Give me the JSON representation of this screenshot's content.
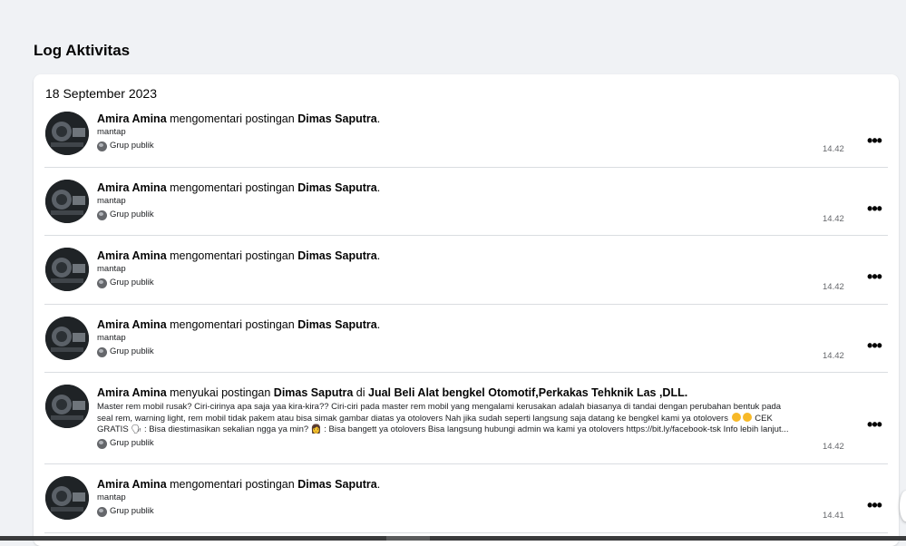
{
  "page": {
    "title": "Log Aktivitas"
  },
  "log": {
    "date": "18 September 2023",
    "entries": [
      {
        "actor": "Amira Amina",
        "action": " mengomentari postingan ",
        "target": "Dimas Saputra",
        "suffix": ".",
        "detail": "mantap",
        "privacy": "Grup publik",
        "time": "14.42"
      },
      {
        "actor": "Amira Amina",
        "action": " mengomentari postingan ",
        "target": "Dimas Saputra",
        "suffix": ".",
        "detail": "mantap",
        "privacy": "Grup publik",
        "time": "14.42"
      },
      {
        "actor": "Amira Amina",
        "action": " mengomentari postingan ",
        "target": "Dimas Saputra",
        "suffix": ".",
        "detail": "mantap",
        "privacy": "Grup publik",
        "time": "14.42"
      },
      {
        "actor": "Amira Amina",
        "action": " mengomentari postingan ",
        "target": "Dimas Saputra",
        "suffix": ".",
        "detail": "mantap",
        "privacy": "Grup publik",
        "time": "14.42"
      },
      {
        "actor": "Amira Amina",
        "action": " menyukai postingan ",
        "target": "Dimas Saputra",
        "connector": " di ",
        "group": "Jual Beli Alat bengkel Otomotif,Perkakas Tehknik Las ,DLL.",
        "detail_line1": "Master rem mobil rusak? Ciri-cirinya apa saja yaa kira-kira?? Ciri-ciri pada master rem mobil yang mengalami kerusakan adalah biasanya di tandai dengan perubahan bentuk pada",
        "detail_line2": "seal rem, warning light, rem mobil tidak pakem atau bisa simak gambar diatas ya otolovers Nah jika sudah seperti langsung saja datang ke bengkel kami ya otolovers",
        "detail_line2_tail": " CEK",
        "detail_line3a": "GRATIS ",
        "detail_line3b": " : Bisa diestimasikan sekalian ngga ya min? ",
        "detail_line3c": " : Bisa bangett ya otolovers Bisa langsung hubungi admin wa kami ya otolovers https://bit.ly/facebook-tsk Info lebih lanjut...",
        "privacy": "Grup publik",
        "time": "14.42"
      },
      {
        "actor": "Amira Amina",
        "action": " mengomentari postingan ",
        "target": "Dimas Saputra",
        "suffix": ".",
        "detail": "mantap",
        "privacy": "Grup publik",
        "time": "14.41"
      }
    ]
  },
  "icons": {
    "more": "more-options-icon",
    "privacy": "globe-icon",
    "avatar": "profile-avatar"
  },
  "colors": {
    "background": "#f0f2f5",
    "card": "#ffffff",
    "divider": "#dadde1",
    "muted": "#65676b"
  }
}
